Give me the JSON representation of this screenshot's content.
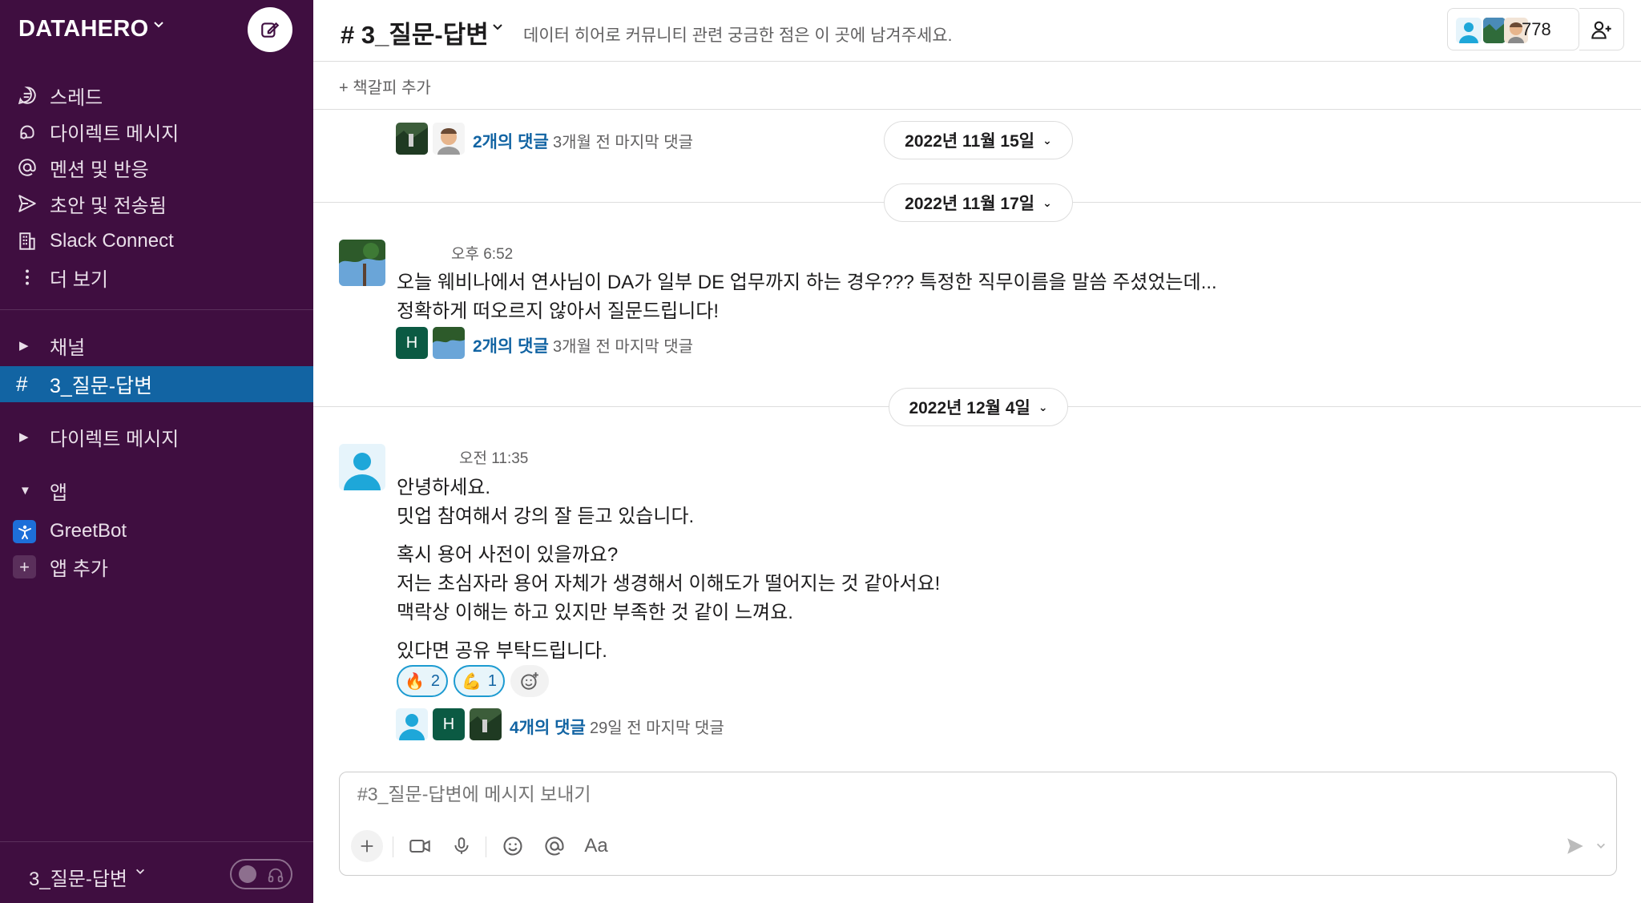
{
  "workspace": {
    "name": "DATAHERO",
    "chevron": "⌄"
  },
  "sidebar": {
    "nav": [
      {
        "label": "스레드",
        "icon": "threads-icon"
      },
      {
        "label": "다이렉트 메시지",
        "icon": "dm-icon"
      },
      {
        "label": "멘션 및 반응",
        "icon": "at-icon"
      },
      {
        "label": "초안 및 전송됨",
        "icon": "send-icon"
      },
      {
        "label": "Slack Connect",
        "icon": "building-icon"
      },
      {
        "label": "더 보기",
        "icon": "more-vertical-icon"
      }
    ],
    "sections": {
      "channels": "채널",
      "active_channel": "3_질문-답변",
      "direct_messages": "다이렉트 메시지",
      "apps": "앱",
      "greetbot": "GreetBot",
      "add_app": "앱 추가"
    },
    "footer": {
      "label": "3_질문-답변"
    }
  },
  "channel": {
    "title": "# 3_질문-답변",
    "topic": "데이터 히어로 커뮤니티 관련 궁금한 점은 이 곳에 남겨주세요.",
    "member_count": "778",
    "bookmark_add": "+  책갈피 추가"
  },
  "messages": {
    "m0": {
      "thread_count": "2개의 댓글",
      "thread_last": "3개월 전 마지막 댓글"
    },
    "date1": "2022년 11월 15일",
    "date2": "2022년 11월 17일",
    "m1": {
      "time": "오후 6:52",
      "line1": "오늘 웨비나에서 연사님이 DA가 일부 DE 업무까지 하는 경우??? 특정한 직무이름을 말씀 주셨었는데...",
      "line2": "정확하게 떠오르지 않아서 질문드립니다!",
      "thread_initial": "H",
      "thread_count": "2개의 댓글",
      "thread_last": "3개월 전 마지막 댓글"
    },
    "date3": "2022년 12월 4일",
    "m2": {
      "time": "오전 11:35",
      "line1": "안녕하세요.",
      "line2": "밋업 참여해서 강의 잘 듣고 있습니다.",
      "line3": "혹시 용어 사전이 있을까요?",
      "line4": "저는 초심자라 용어 자체가 생경해서 이해도가 떨어지는 것 같아서요!",
      "line5": "맥락상 이해는 하고 있지만 부족한 것 같이 느껴요.",
      "line6": "있다면 공유 부탁드립니다.",
      "reactions": [
        {
          "emoji": "🔥",
          "count": "2"
        },
        {
          "emoji": "💪",
          "count": "1"
        }
      ],
      "thread_initial": "H",
      "thread_count": "4개의 댓글",
      "thread_last": "29일 전 마지막 댓글"
    }
  },
  "composer": {
    "placeholder": "#3_질문-답변에 메시지 보내기",
    "format_label": "Aa"
  },
  "colors": {
    "sidebar": "#3f0e40",
    "active": "#1264a3",
    "link": "#1264a3"
  }
}
